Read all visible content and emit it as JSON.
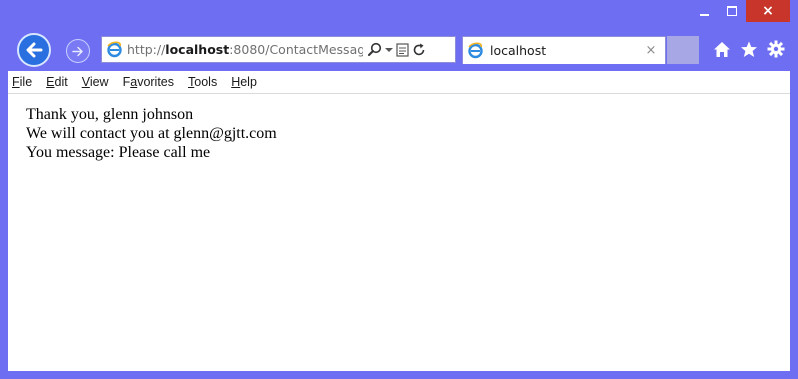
{
  "window": {
    "minimize_icon": "minimize-icon",
    "maximize_icon": "maximize-icon",
    "close_label": "×",
    "frame_color": "#6e6ef2",
    "close_color": "#c7352b"
  },
  "nav": {
    "back_icon": "back-arrow-icon",
    "forward_icon": "forward-arrow-icon"
  },
  "address_bar": {
    "url_prefix": "http://",
    "url_host": "localhost",
    "url_rest": ":8080/ContactMessag",
    "search_icon": "search-icon",
    "dropdown_icon": "chevron-down-icon",
    "compat_icon": "compatibility-view-icon",
    "refresh_icon": "refresh-icon"
  },
  "tab": {
    "label": "localhost",
    "close_label": "×"
  },
  "toolbar": {
    "home_icon": "home-icon",
    "favorites_icon": "star-icon",
    "tools_icon": "gear-icon"
  },
  "menu": {
    "items": [
      {
        "accel": "F",
        "rest": "ile"
      },
      {
        "accel": "E",
        "rest": "dit"
      },
      {
        "accel": "V",
        "rest": "iew"
      },
      {
        "accel": "a",
        "pre": "F",
        "rest": "vorites"
      },
      {
        "accel": "T",
        "rest": "ools"
      },
      {
        "accel": "H",
        "rest": "elp"
      }
    ]
  },
  "page": {
    "line1": "Thank you, glenn johnson",
    "line2": "We will contact you at glenn@gjtt.com",
    "line3": "You message: Please call me"
  }
}
